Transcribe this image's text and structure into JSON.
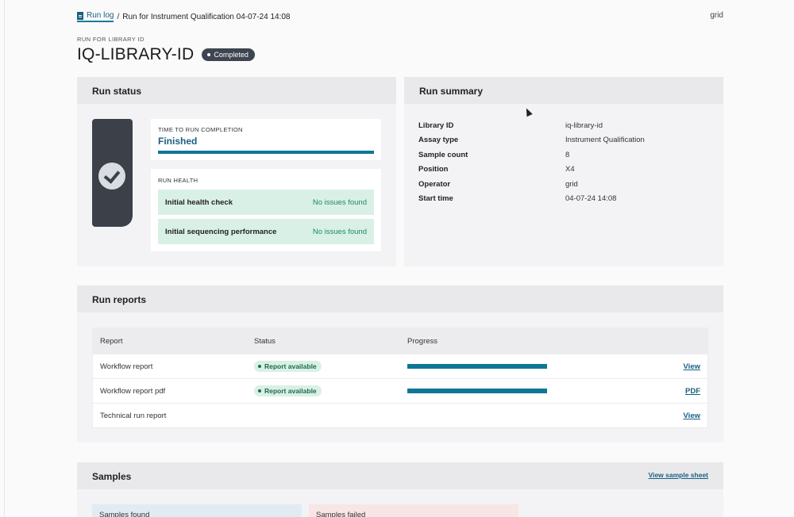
{
  "breadcrumb": {
    "root": "Run log",
    "separator": "/",
    "current": "Run for Instrument Qualification 04-07-24 14:08"
  },
  "user": "grid",
  "header": {
    "caption": "RUN FOR LIBRARY ID",
    "title": "IQ-LIBRARY-ID",
    "badge": "Completed"
  },
  "run_status": {
    "title": "Run status",
    "completion_label": "TIME TO RUN COMPLETION",
    "completion_value": "Finished",
    "completion_progress": 1.0,
    "health_label": "RUN HEALTH",
    "health_checks": [
      {
        "name": "Initial health check",
        "status": "No issues found"
      },
      {
        "name": "Initial sequencing performance",
        "status": "No issues found"
      }
    ]
  },
  "run_summary": {
    "title": "Run summary",
    "rows": [
      {
        "key": "Library ID",
        "value": "iq-library-id"
      },
      {
        "key": "Assay type",
        "value": "Instrument Qualification"
      },
      {
        "key": "Sample count",
        "value": "8"
      },
      {
        "key": "Position",
        "value": "X4"
      },
      {
        "key": "Operator",
        "value": "grid"
      },
      {
        "key": "Start time",
        "value": "04-07-24 14:08"
      }
    ]
  },
  "run_reports": {
    "title": "Run reports",
    "columns": [
      "Report",
      "Status",
      "Progress"
    ],
    "rows": [
      {
        "report": "Workflow report",
        "status": "Report available",
        "progress": 1.0,
        "action": "View"
      },
      {
        "report": "Workflow report pdf",
        "status": "Report available",
        "progress": 1.0,
        "action": "PDF"
      },
      {
        "report": "Technical run report",
        "status": "",
        "progress": null,
        "action": "View"
      }
    ]
  },
  "samples": {
    "title": "Samples",
    "link": "View sample sheet",
    "found_label": "Samples found",
    "failed_label": "Samples failed"
  },
  "colors": {
    "accent": "#0f7698",
    "link": "#1a5f82",
    "success_bg": "#d9f0e6",
    "success_text": "#1d8a5a",
    "dark": "#3b4049"
  }
}
